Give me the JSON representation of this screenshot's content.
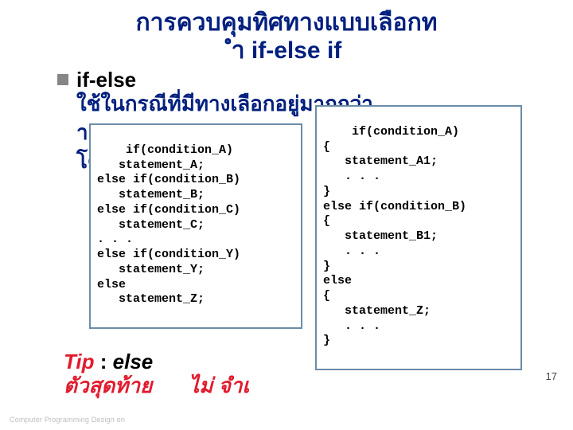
{
  "title_line1": "การควบคุมทิศทางแบบเลือกท",
  "title_line2": "ำ   if-else if",
  "bullet": {
    "head": "if-else",
    "line1": "ใช้ในกรณีที่มีทางเลือกอยู่มากกว่า",
    "line2_a": "าส",
    "line2_b": "โด"
  },
  "code_left": "if(condition_A)\n   statement_A;\nelse if(condition_B)\n   statement_B;\nelse if(condition_C)\n   statement_C;\n. . .\nelse if(condition_Y)\n   statement_Y;\nelse\n   statement_Z;",
  "code_right": "if(condition_A)\n{\n   statement_A1;\n   . . .\n}\nelse if(condition_B)\n{\n   statement_B1;\n   . . .\n}\nelse\n{\n   statement_Z;\n   . . .\n}",
  "tip": {
    "label": "Tip",
    "colon": " : ",
    "else_word": "else",
    "rest1": "ตัวสุดท้าย",
    "rest2": "ไม่  จำเ"
  },
  "page_number": "17",
  "footer": "Computer Programming Design                                                                                                                                                    on"
}
